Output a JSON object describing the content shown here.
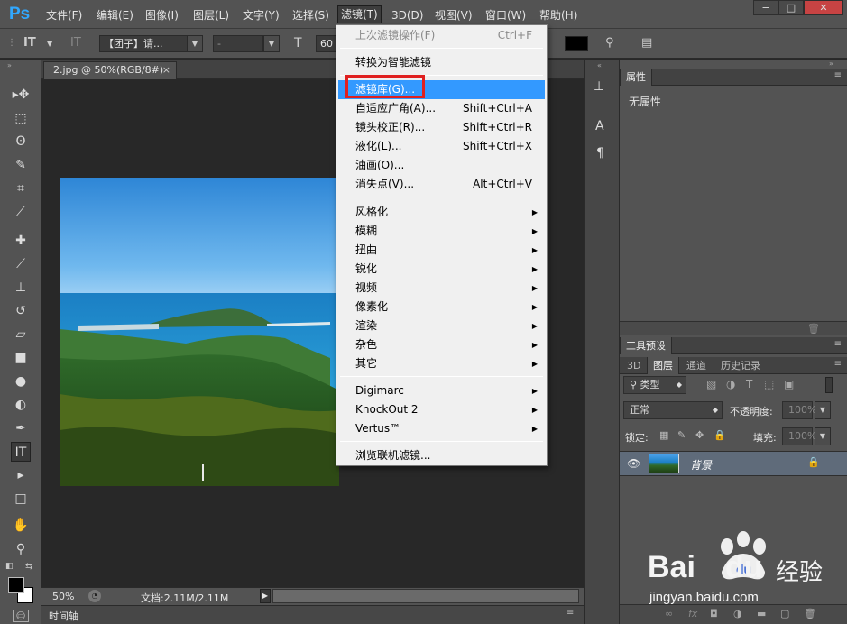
{
  "app": {
    "logo": "Ps"
  },
  "menubar": {
    "items": [
      "文件(F)",
      "编辑(E)",
      "图像(I)",
      "图层(L)",
      "文字(Y)",
      "选择(S)",
      "滤镜(T)",
      "3D(D)",
      "视图(V)",
      "窗口(W)",
      "帮助(H)"
    ],
    "active": "滤镜(T)"
  },
  "window_controls": {
    "minimize": "−",
    "maximize": "□",
    "close": "✕"
  },
  "options_bar": {
    "font_family": "【团子】请...",
    "font_style": "-",
    "font_size": "60",
    "color_swatch": "#000000"
  },
  "document": {
    "tab_label": "2.jpg @ 50%(RGB/8#)",
    "close": "×"
  },
  "status": {
    "zoom": "50%",
    "doc_info": "文档:2.11M/2.11M",
    "timeline_label": "时间轴"
  },
  "filter_menu": {
    "items": [
      {
        "label": "上次滤镜操作(F)",
        "shortcut": "Ctrl+F",
        "disabled": true
      },
      {
        "label": "转换为智能滤镜"
      },
      {
        "label": "滤镜库(G)...",
        "highlighted": true
      },
      {
        "label": "自适应广角(A)...",
        "shortcut": "Shift+Ctrl+A"
      },
      {
        "label": "镜头校正(R)...",
        "shortcut": "Shift+Ctrl+R"
      },
      {
        "label": "液化(L)...",
        "shortcut": "Shift+Ctrl+X"
      },
      {
        "label": "油画(O)..."
      },
      {
        "label": "消失点(V)...",
        "shortcut": "Alt+Ctrl+V"
      },
      {
        "label": "风格化",
        "submenu": true
      },
      {
        "label": "模糊",
        "submenu": true
      },
      {
        "label": "扭曲",
        "submenu": true
      },
      {
        "label": "锐化",
        "submenu": true
      },
      {
        "label": "视频",
        "submenu": true
      },
      {
        "label": "像素化",
        "submenu": true
      },
      {
        "label": "渲染",
        "submenu": true
      },
      {
        "label": "杂色",
        "submenu": true
      },
      {
        "label": "其它",
        "submenu": true
      },
      {
        "label": "Digimarc",
        "submenu": true
      },
      {
        "label": "KnockOut 2",
        "submenu": true
      },
      {
        "label": "Vertus™",
        "submenu": true
      },
      {
        "label": "浏览联机滤镜..."
      }
    ]
  },
  "properties_panel": {
    "tab": "属性",
    "content": "无属性"
  },
  "tool_presets_panel": {
    "tab": "工具预设"
  },
  "layers_panel": {
    "tabs": [
      "3D",
      "图层",
      "通道",
      "历史记录"
    ],
    "active_tab": "图层",
    "filter_kind": "类型",
    "blend_mode": "正常",
    "opacity_label": "不透明度:",
    "opacity_value": "100%",
    "lock_label": "锁定:",
    "fill_label": "填充:",
    "fill_value": "100%",
    "layers": [
      {
        "name": "背景",
        "locked": true,
        "visible": true
      }
    ],
    "footer_fx": "fx"
  },
  "watermark": {
    "brand": "Bai",
    "brand2": "du",
    "suffix": "经验",
    "url": "jingyan.baidu.com"
  },
  "colors": {
    "accent": "#3399ff",
    "highlight_box": "#e02020",
    "ps_blue": "#31a8ff"
  }
}
